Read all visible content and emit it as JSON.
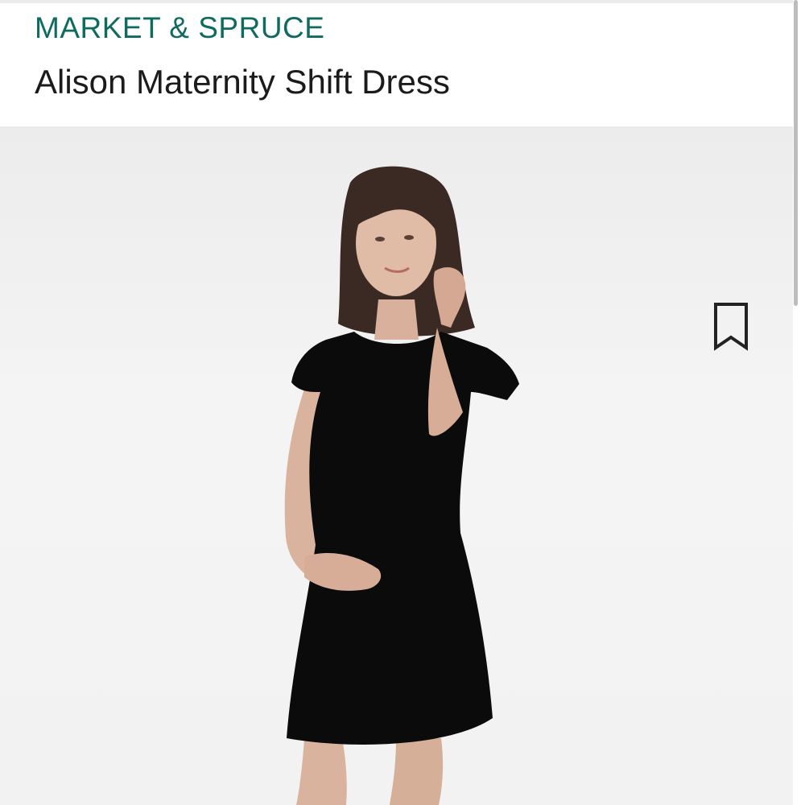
{
  "header": {
    "brand": "MARKET & SPRUCE",
    "title": "Alison Maternity Shift Dress"
  },
  "icons": {
    "save": "bookmark-icon"
  },
  "colors": {
    "brand": "#0f6b60",
    "title": "#1b1b1b",
    "image_background": "#f1f1f1",
    "dress": "#0b0b0b"
  }
}
